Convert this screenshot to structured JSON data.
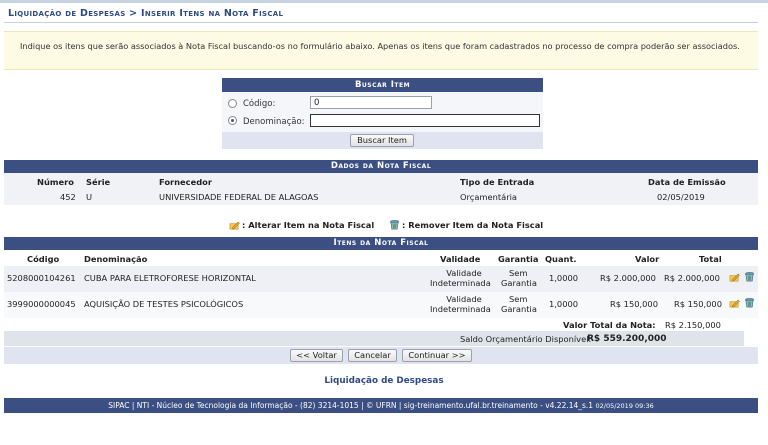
{
  "page": {
    "title": "Liquidação de Despesas > Inserir Itens na Nota Fiscal",
    "info": "Indique os itens que serão associados à Nota Fiscal buscando-os no formulário abaixo. Apenas os itens que foram cadastrados no processo de compra poderão ser associados."
  },
  "search": {
    "title": "Buscar Item",
    "codigo_label": "Código:",
    "codigo_value": "0",
    "denominacao_label": "Denominação:",
    "denominacao_value": "",
    "selected": "denominacao",
    "button": "Buscar Item"
  },
  "nota_fiscal": {
    "title": "Dados da Nota Fiscal",
    "headers": {
      "numero": "Número",
      "serie": "Série",
      "fornecedor": "Fornecedor",
      "tipo": "Tipo de Entrada",
      "data": "Data de Emissão"
    },
    "row": {
      "numero": "452",
      "serie": "U",
      "fornecedor": "UNIVERSIDADE FEDERAL DE ALAGOAS",
      "tipo": "Orçamentária",
      "data": "02/05/2019"
    }
  },
  "legend": {
    "alterar": ": Alterar Item na Nota Fiscal",
    "remover": ": Remover Item da Nota Fiscal"
  },
  "itens": {
    "title": "Itens da Nota Fiscal",
    "headers": {
      "codigo": "Código",
      "denominacao": "Denominação",
      "validade": "Validade",
      "garantia": "Garantia",
      "quant": "Quant.",
      "valor": "Valor",
      "total": "Total"
    },
    "rows": [
      {
        "codigo": "5208000104261",
        "denominacao": "CUBA PARA ELETROFORESE HORIZONTAL",
        "validade_1": "Validade",
        "validade_2": "Indeterminada",
        "garantia_1": "Sem",
        "garantia_2": "Garantia",
        "quant": "1,0000",
        "valor": "R$ 2.000,000",
        "total": "R$ 2.000,000"
      },
      {
        "codigo": "3999000000045",
        "denominacao": "AQUISIÇÃO DE TESTES PSICOLÓGICOS",
        "validade_1": "Validade",
        "validade_2": "Indeterminada",
        "garantia_1": "Sem",
        "garantia_2": "Garantia",
        "quant": "1,0000",
        "valor": "R$ 150,000",
        "total": "R$ 150,000"
      }
    ],
    "valor_total_label": "Valor Total da Nota:",
    "valor_total": "R$ 2.150,000",
    "saldo_label": "Saldo Orçamentário Disponível:",
    "saldo": "R$ 559.200,000"
  },
  "buttons": {
    "voltar": "<< Voltar",
    "cancelar": "Cancelar",
    "continuar": "Continuar >>"
  },
  "bottom_link": "Liquidação de Despesas",
  "footer": "SIPAC | NTI - Núcleo de Tecnologia da Informação - (82) 3214-1015 | © UFRN | sig-treinamento.ufal.br.treinamento - v4.22.14_s.1",
  "footer_time": "02/05/2019 09:36",
  "colors": {
    "header": "#3b4f83",
    "title": "#2d4a82",
    "info_bg": "#fdfbe3"
  },
  "icons": {
    "alterar": "pencil-folder-icon",
    "remover": "trash-icon"
  }
}
